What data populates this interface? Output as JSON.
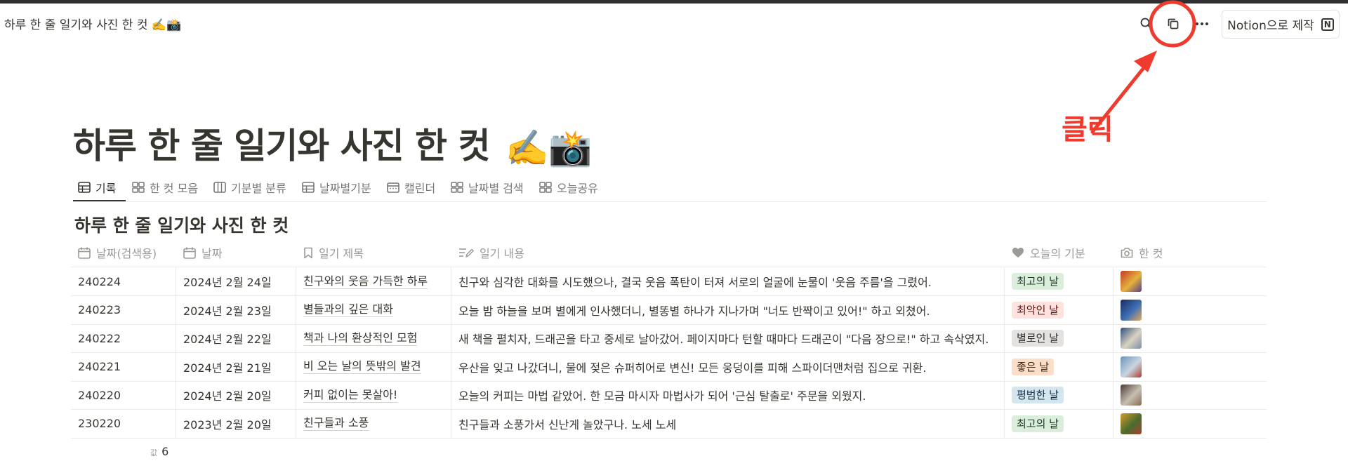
{
  "topbar": {
    "page_crumb": "하루 한 줄 일기와 사진 한 컷 ✍️📸",
    "notion_button": "Notion으로 제작"
  },
  "annotation": {
    "label": "클릭",
    "color": "#ee3b2e"
  },
  "page": {
    "title": "하루 한 줄 일기와 사진 한 컷",
    "title_emoji": "✍️📸"
  },
  "tabs": [
    {
      "label": "기록",
      "icon": "table-icon",
      "active": true
    },
    {
      "label": "한 컷 모음",
      "icon": "gallery-icon",
      "active": false
    },
    {
      "label": "기분별 분류",
      "icon": "board-icon",
      "active": false
    },
    {
      "label": "날짜별기분",
      "icon": "table-icon",
      "active": false
    },
    {
      "label": "캘린더",
      "icon": "calendar-icon",
      "active": false
    },
    {
      "label": "날짜별 검색",
      "icon": "gallery-icon",
      "active": false
    },
    {
      "label": "오늘공유",
      "icon": "gallery-icon",
      "active": false
    }
  ],
  "database": {
    "title": "하루 한 줄 일기와 사진 한 컷",
    "columns": [
      {
        "label": "날짜(검색용)",
        "icon": "calendar-icon"
      },
      {
        "label": "날짜",
        "icon": "calendar-icon"
      },
      {
        "label": "일기 제목",
        "icon": "bookmark-icon"
      },
      {
        "label": "일기 내용",
        "icon": "text-edit-icon"
      },
      {
        "label": "오늘의 기분",
        "icon": "heart-icon"
      },
      {
        "label": "한 컷",
        "icon": "camera-icon"
      }
    ],
    "rows": [
      {
        "code": "240224",
        "date": "2024년 2월 24일",
        "title": "친구와의 웃음 가득한 하루",
        "content": "친구와 심각한 대화를 시도했으나, 결국 웃음 폭탄이 터져 서로의 얼굴에 눈물이 '웃음 주름'을 그렸어.",
        "mood": "최고의 날",
        "mood_bg": "#dbeddb",
        "mood_fg": "#1c3829",
        "thumb": [
          "#c43a2a",
          "#e3b23c",
          "#5a3d8a"
        ]
      },
      {
        "code": "240223",
        "date": "2024년 2월 23일",
        "title": "별들과의 깊은 대화",
        "content": "오늘 밤 하늘을 보며 별에게 인사했더니, 별똥별 하나가 지나가며 \"너도 반짝이고 있어!\" 하고 외쳤어.",
        "mood": "최악인 날",
        "mood_bg": "#ffe2dd",
        "mood_fg": "#5d1715",
        "thumb": [
          "#1b2a5e",
          "#3f6fb5",
          "#e6a85a"
        ]
      },
      {
        "code": "240222",
        "date": "2024년 2월 22일",
        "title": "책과 나의 환상적인 모험",
        "content": "새 책을 펼치자, 드래곤을 타고 중세로 날아갔어. 페이지마다 턴할 때마다 드래곤이 \"다음 장으로!\" 하고 속삭였지.",
        "mood": "별로인 날",
        "mood_bg": "#e3e2e0",
        "mood_fg": "#32302c",
        "thumb": [
          "#2d4f7a",
          "#d9d2c0",
          "#7a8fa8"
        ]
      },
      {
        "code": "240221",
        "date": "2024년 2월 21일",
        "title": "비 오는 날의 뜻밖의 발견",
        "content": "우산을 잊고 나갔더니, 물에 젖은 슈퍼히어로 변신! 모든 웅덩이를 피해 스파이더맨처럼 집으로 귀환.",
        "mood": "좋은 날",
        "mood_bg": "#fadec9",
        "mood_fg": "#49290e",
        "thumb": [
          "#6f93b8",
          "#c9d6e2",
          "#b23a30"
        ]
      },
      {
        "code": "240220",
        "date": "2024년 2월 20일",
        "title": "커피 없이는 못살아!",
        "content": "오늘의 커피는 마법 같았어. 한 모금 마시자 마법사가 되어 '근심 탈출로' 주문을 외웠지.",
        "mood": "평범한 날",
        "mood_bg": "#d3e5ef",
        "mood_fg": "#183347",
        "thumb": [
          "#4a3a34",
          "#c8bfb2",
          "#8a6a52"
        ]
      },
      {
        "code": "230220",
        "date": "2023년 2월 20일",
        "title": "친구들과 소풍",
        "content": "친구들과 소풍가서 신난게 놀았구나. 노세 노세",
        "mood": "최고의 날",
        "mood_bg": "#dbeddb",
        "mood_fg": "#1c3829",
        "thumb": [
          "#d49a2c",
          "#4b6b2e",
          "#a8432a"
        ]
      }
    ],
    "count_label": "값",
    "count_value": "6"
  }
}
